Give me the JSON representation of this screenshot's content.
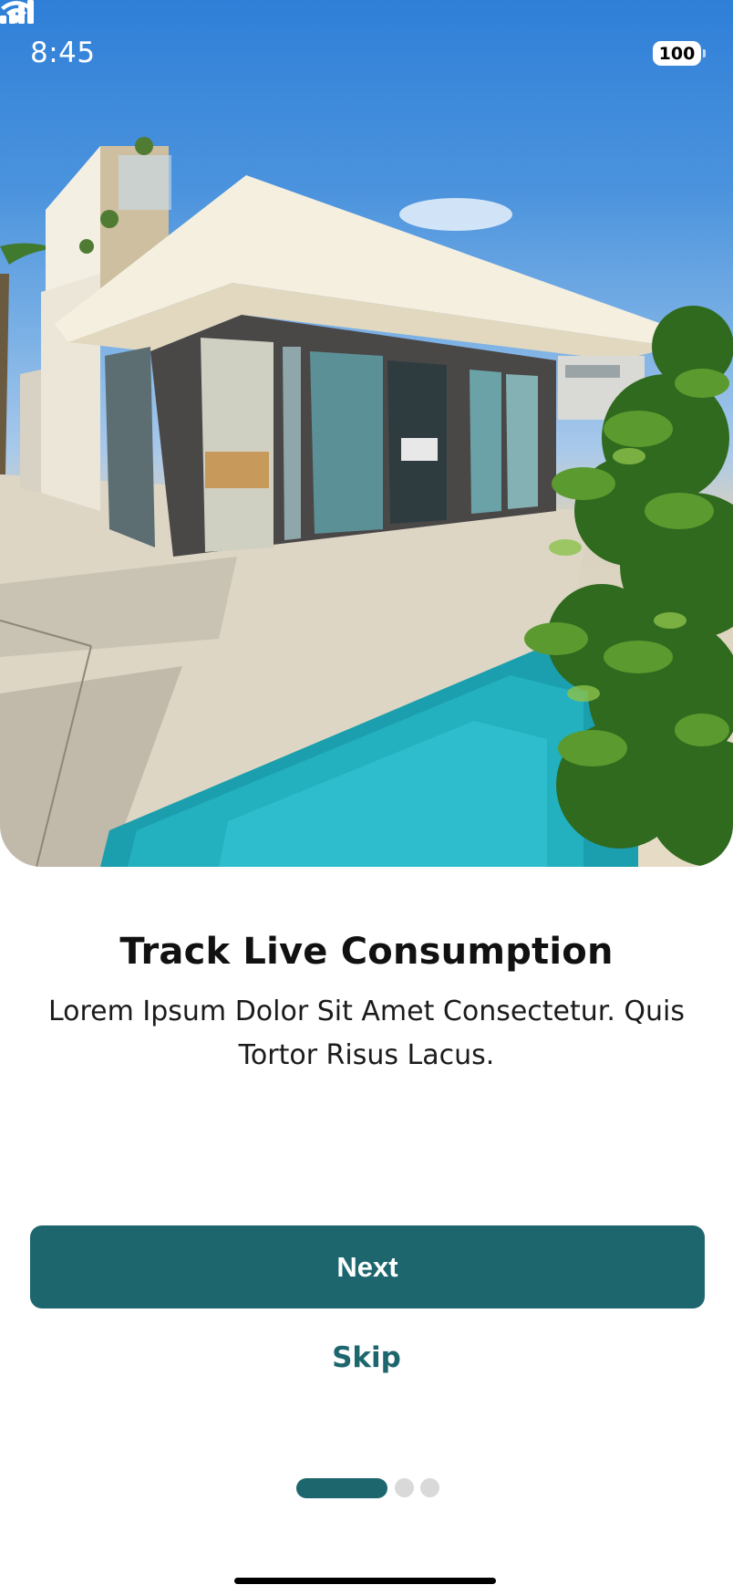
{
  "status_bar": {
    "time": "8:45",
    "battery": "100",
    "icons": [
      "signal-icon",
      "wifi-icon",
      "battery-icon"
    ]
  },
  "hero": {
    "image": "modern-villa-with-pool-photo"
  },
  "onboarding": {
    "title": "Track Live Consumption",
    "description": "Lorem Ipsum Dolor Sit Amet Consectetur. Quis Tortor Risus Lacus.",
    "next_label": "Next",
    "skip_label": "Skip",
    "current_page": 1,
    "total_pages": 3
  },
  "colors": {
    "primary": "#1e666e",
    "dot_inactive": "#d9d9d9",
    "text": "#111111"
  }
}
